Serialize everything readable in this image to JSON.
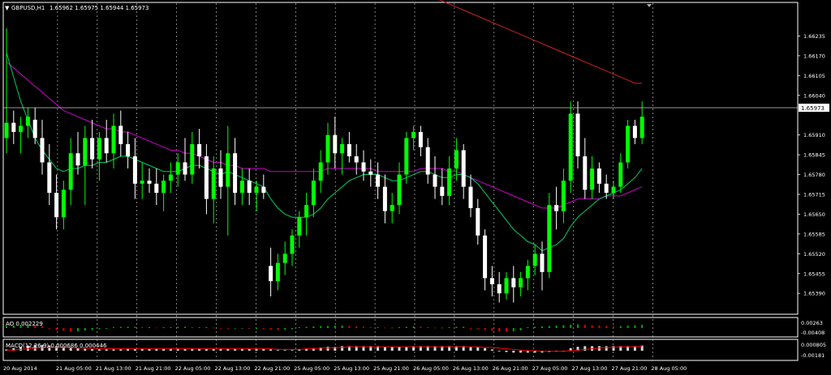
{
  "header": {
    "symbol": "GBPUSD,H1",
    "ohlc": "1.65962 1.65975 1.65944 1.65973",
    "menu_icon": "triangle-down-icon",
    "scroll_marker_icon": "triangle-down-icon"
  },
  "colors": {
    "background": "#000000",
    "bull_candle": "#00ff00",
    "bear_candle": "#ffffff",
    "ma_fast": "#00cc66",
    "ma_mid": "#cc00cc",
    "ma_slow": "#cc2222",
    "grid": "#d0d0d0",
    "ao_up": "#00aa00",
    "ao_down": "#dd0000",
    "macd_hist": "#d8d8d8",
    "macd_signal": "#ff0000"
  },
  "price_axis": {
    "labels": [
      "1.66235",
      "1.66170",
      "1.66105",
      "1.66040",
      "1.65910",
      "1.65845",
      "1.65780",
      "1.65715",
      "1.65650",
      "1.65585",
      "1.65520",
      "1.65455",
      "1.65390"
    ],
    "current_price": "1.65973"
  },
  "time_axis": {
    "labels": [
      "20 Aug 2014",
      "21 Aug 05:00",
      "21 Aug 13:00",
      "21 Aug 21:00",
      "22 Aug 05:00",
      "22 Aug 13:00",
      "22 Aug 21:00",
      "25 Aug 05:00",
      "25 Aug 13:00",
      "25 Aug 21:00",
      "26 Aug 05:00",
      "26 Aug 13:00",
      "26 Aug 21:00",
      "27 Aug 05:00",
      "27 Aug 13:00",
      "27 Aug 21:00",
      "28 Aug 05:00"
    ]
  },
  "ao_panel": {
    "title": "AO 0.002229",
    "labels": [
      "0.00263",
      "-0.00408"
    ]
  },
  "macd_panel": {
    "title": "MACD(12,26,9) 0.000686 0.000446",
    "labels": [
      "0.000805",
      "-0.00181"
    ]
  },
  "chart_data": {
    "type": "candlestick",
    "title": "GBPUSD,H1",
    "ylim": [
      1.6534,
      1.663
    ],
    "candles": [
      {
        "o": 1.659,
        "h": 1.6626,
        "l": 1.6585,
        "c": 1.6595
      },
      {
        "o": 1.6595,
        "h": 1.6599,
        "l": 1.6588,
        "c": 1.6592
      },
      {
        "o": 1.6592,
        "h": 1.6597,
        "l": 1.6585,
        "c": 1.6594
      },
      {
        "o": 1.6594,
        "h": 1.66,
        "l": 1.659,
        "c": 1.6597
      },
      {
        "o": 1.6596,
        "h": 1.66,
        "l": 1.6588,
        "c": 1.659
      },
      {
        "o": 1.659,
        "h": 1.6596,
        "l": 1.6578,
        "c": 1.6582
      },
      {
        "o": 1.6582,
        "h": 1.6588,
        "l": 1.6568,
        "c": 1.6572
      },
      {
        "o": 1.6572,
        "h": 1.6578,
        "l": 1.656,
        "c": 1.6564
      },
      {
        "o": 1.6564,
        "h": 1.6576,
        "l": 1.656,
        "c": 1.6573
      },
      {
        "o": 1.6573,
        "h": 1.659,
        "l": 1.6568,
        "c": 1.6585
      },
      {
        "o": 1.6585,
        "h": 1.6592,
        "l": 1.6578,
        "c": 1.6581
      },
      {
        "o": 1.6581,
        "h": 1.6594,
        "l": 1.6568,
        "c": 1.659
      },
      {
        "o": 1.659,
        "h": 1.6596,
        "l": 1.658,
        "c": 1.6583
      },
      {
        "o": 1.6583,
        "h": 1.6592,
        "l": 1.6576,
        "c": 1.659
      },
      {
        "o": 1.659,
        "h": 1.6596,
        "l": 1.6582,
        "c": 1.6585
      },
      {
        "o": 1.6585,
        "h": 1.6598,
        "l": 1.658,
        "c": 1.6594
      },
      {
        "o": 1.6594,
        "h": 1.6599,
        "l": 1.6584,
        "c": 1.6588
      },
      {
        "o": 1.6588,
        "h": 1.6592,
        "l": 1.658,
        "c": 1.6584
      },
      {
        "o": 1.6584,
        "h": 1.659,
        "l": 1.657,
        "c": 1.6575
      },
      {
        "o": 1.6575,
        "h": 1.6582,
        "l": 1.657,
        "c": 1.6576
      },
      {
        "o": 1.6576,
        "h": 1.658,
        "l": 1.6572,
        "c": 1.6575
      },
      {
        "o": 1.6575,
        "h": 1.658,
        "l": 1.6568,
        "c": 1.6572
      },
      {
        "o": 1.6572,
        "h": 1.6578,
        "l": 1.6566,
        "c": 1.6576
      },
      {
        "o": 1.6576,
        "h": 1.6582,
        "l": 1.6572,
        "c": 1.6578
      },
      {
        "o": 1.6578,
        "h": 1.6585,
        "l": 1.6574,
        "c": 1.6582
      },
      {
        "o": 1.6582,
        "h": 1.659,
        "l": 1.6576,
        "c": 1.6578
      },
      {
        "o": 1.6578,
        "h": 1.6592,
        "l": 1.6575,
        "c": 1.6588
      },
      {
        "o": 1.6588,
        "h": 1.6593,
        "l": 1.658,
        "c": 1.6584
      },
      {
        "o": 1.6584,
        "h": 1.6588,
        "l": 1.6565,
        "c": 1.657
      },
      {
        "o": 1.657,
        "h": 1.6584,
        "l": 1.6562,
        "c": 1.658
      },
      {
        "o": 1.658,
        "h": 1.6586,
        "l": 1.657,
        "c": 1.6574
      },
      {
        "o": 1.6574,
        "h": 1.6594,
        "l": 1.6558,
        "c": 1.6585
      },
      {
        "o": 1.6585,
        "h": 1.659,
        "l": 1.6568,
        "c": 1.6572
      },
      {
        "o": 1.6572,
        "h": 1.658,
        "l": 1.6568,
        "c": 1.6576
      },
      {
        "o": 1.6576,
        "h": 1.658,
        "l": 1.6568,
        "c": 1.6572
      },
      {
        "o": 1.6572,
        "h": 1.6576,
        "l": 1.6566,
        "c": 1.6574
      },
      {
        "o": 1.6574,
        "h": 1.6578,
        "l": 1.657,
        "c": 1.6572
      },
      {
        "o": 1.6548,
        "h": 1.6554,
        "l": 1.6538,
        "c": 1.6543
      },
      {
        "o": 1.6543,
        "h": 1.6552,
        "l": 1.654,
        "c": 1.6549
      },
      {
        "o": 1.6549,
        "h": 1.6556,
        "l": 1.6545,
        "c": 1.6552
      },
      {
        "o": 1.6552,
        "h": 1.656,
        "l": 1.6548,
        "c": 1.6558
      },
      {
        "o": 1.6558,
        "h": 1.6566,
        "l": 1.6554,
        "c": 1.6564
      },
      {
        "o": 1.6564,
        "h": 1.6572,
        "l": 1.6558,
        "c": 1.6568
      },
      {
        "o": 1.6568,
        "h": 1.658,
        "l": 1.6564,
        "c": 1.6576
      },
      {
        "o": 1.6576,
        "h": 1.6586,
        "l": 1.6572,
        "c": 1.6582
      },
      {
        "o": 1.6582,
        "h": 1.6595,
        "l": 1.6578,
        "c": 1.6591
      },
      {
        "o": 1.6591,
        "h": 1.6597,
        "l": 1.658,
        "c": 1.6585
      },
      {
        "o": 1.6585,
        "h": 1.659,
        "l": 1.6578,
        "c": 1.6588
      },
      {
        "o": 1.6588,
        "h": 1.6592,
        "l": 1.6582,
        "c": 1.6584
      },
      {
        "o": 1.6584,
        "h": 1.6588,
        "l": 1.6578,
        "c": 1.6582
      },
      {
        "o": 1.6582,
        "h": 1.6586,
        "l": 1.6576,
        "c": 1.6579
      },
      {
        "o": 1.6579,
        "h": 1.6583,
        "l": 1.6574,
        "c": 1.6578
      },
      {
        "o": 1.6578,
        "h": 1.6582,
        "l": 1.657,
        "c": 1.6574
      },
      {
        "o": 1.6574,
        "h": 1.6578,
        "l": 1.6562,
        "c": 1.6566
      },
      {
        "o": 1.6566,
        "h": 1.6572,
        "l": 1.6562,
        "c": 1.6568
      },
      {
        "o": 1.6568,
        "h": 1.6582,
        "l": 1.6565,
        "c": 1.6578
      },
      {
        "o": 1.6578,
        "h": 1.6592,
        "l": 1.6575,
        "c": 1.659
      },
      {
        "o": 1.659,
        "h": 1.6594,
        "l": 1.6586,
        "c": 1.6592
      },
      {
        "o": 1.6592,
        "h": 1.6594,
        "l": 1.6584,
        "c": 1.6587
      },
      {
        "o": 1.6587,
        "h": 1.659,
        "l": 1.6575,
        "c": 1.6578
      },
      {
        "o": 1.6578,
        "h": 1.6584,
        "l": 1.657,
        "c": 1.6574
      },
      {
        "o": 1.6574,
        "h": 1.658,
        "l": 1.6568,
        "c": 1.6571
      },
      {
        "o": 1.6571,
        "h": 1.6584,
        "l": 1.6568,
        "c": 1.658
      },
      {
        "o": 1.658,
        "h": 1.659,
        "l": 1.6576,
        "c": 1.6586
      },
      {
        "o": 1.6586,
        "h": 1.6588,
        "l": 1.657,
        "c": 1.6574
      },
      {
        "o": 1.6574,
        "h": 1.6578,
        "l": 1.6564,
        "c": 1.6567
      },
      {
        "o": 1.6567,
        "h": 1.657,
        "l": 1.6555,
        "c": 1.6558
      },
      {
        "o": 1.6558,
        "h": 1.656,
        "l": 1.654,
        "c": 1.6544
      },
      {
        "o": 1.6544,
        "h": 1.6548,
        "l": 1.6538,
        "c": 1.6542
      },
      {
        "o": 1.6542,
        "h": 1.6546,
        "l": 1.6536,
        "c": 1.6539
      },
      {
        "o": 1.6539,
        "h": 1.6546,
        "l": 1.6537,
        "c": 1.6544
      },
      {
        "o": 1.6544,
        "h": 1.6548,
        "l": 1.6536,
        "c": 1.6541
      },
      {
        "o": 1.6541,
        "h": 1.6546,
        "l": 1.6538,
        "c": 1.6544
      },
      {
        "o": 1.6544,
        "h": 1.655,
        "l": 1.654,
        "c": 1.6548
      },
      {
        "o": 1.6548,
        "h": 1.6555,
        "l": 1.6545,
        "c": 1.6552
      },
      {
        "o": 1.6552,
        "h": 1.6556,
        "l": 1.654,
        "c": 1.6546
      },
      {
        "o": 1.6546,
        "h": 1.6572,
        "l": 1.6544,
        "c": 1.6568
      },
      {
        "o": 1.6568,
        "h": 1.6574,
        "l": 1.656,
        "c": 1.6566
      },
      {
        "o": 1.6566,
        "h": 1.658,
        "l": 1.6562,
        "c": 1.6576
      },
      {
        "o": 1.6576,
        "h": 1.6602,
        "l": 1.6572,
        "c": 1.6598
      },
      {
        "o": 1.6598,
        "h": 1.6602,
        "l": 1.658,
        "c": 1.6584
      },
      {
        "o": 1.6584,
        "h": 1.659,
        "l": 1.657,
        "c": 1.6573
      },
      {
        "o": 1.6573,
        "h": 1.6584,
        "l": 1.657,
        "c": 1.658
      },
      {
        "o": 1.658,
        "h": 1.6582,
        "l": 1.6572,
        "c": 1.6575
      },
      {
        "o": 1.6575,
        "h": 1.6578,
        "l": 1.657,
        "c": 1.6572
      },
      {
        "o": 1.6572,
        "h": 1.6576,
        "l": 1.657,
        "c": 1.6574
      },
      {
        "o": 1.6574,
        "h": 1.6585,
        "l": 1.6572,
        "c": 1.6582
      },
      {
        "o": 1.6582,
        "h": 1.6596,
        "l": 1.658,
        "c": 1.6594
      },
      {
        "o": 1.6594,
        "h": 1.6596,
        "l": 1.6588,
        "c": 1.659
      },
      {
        "o": 1.659,
        "h": 1.6602,
        "l": 1.6588,
        "c": 1.6597
      }
    ],
    "ma_fast": [
      1.6618,
      1.661,
      1.6602,
      1.6596,
      1.659,
      1.6586,
      1.6583,
      1.658,
      1.6579,
      1.658,
      1.658,
      1.6581,
      1.6581,
      1.6582,
      1.6582,
      1.6583,
      1.6584,
      1.6584,
      1.6583,
      1.6582,
      1.6581,
      1.658,
      1.6579,
      1.6579,
      1.6579,
      1.658,
      1.6581,
      1.6581,
      1.658,
      1.6579,
      1.6578,
      1.6579,
      1.6578,
      1.6577,
      1.6576,
      1.6575,
      1.6574,
      1.657,
      1.6567,
      1.6565,
      1.6564,
      1.6564,
      1.6564,
      1.6565,
      1.6567,
      1.657,
      1.6572,
      1.6574,
      1.6576,
      1.6577,
      1.6578,
      1.6578,
      1.6578,
      1.6577,
      1.6576,
      1.6576,
      1.6577,
      1.6578,
      1.6579,
      1.6579,
      1.6578,
      1.6577,
      1.6577,
      1.6578,
      1.6578,
      1.6577,
      1.6575,
      1.6572,
      1.6569,
      1.6566,
      1.6563,
      1.656,
      1.6558,
      1.6556,
      1.6555,
      1.6553,
      1.6554,
      1.6555,
      1.6557,
      1.6561,
      1.6564,
      1.6566,
      1.6568,
      1.657,
      1.6571,
      1.6572,
      1.6573,
      1.6575,
      1.6577,
      1.658
    ],
    "ma_mid": [
      1.6615,
      1.6613,
      1.6611,
      1.6609,
      1.6607,
      1.6605,
      1.6603,
      1.6601,
      1.6599,
      1.6598,
      1.6597,
      1.6596,
      1.6595,
      1.6594,
      1.6593,
      1.6593,
      1.6592,
      1.6592,
      1.6591,
      1.659,
      1.6589,
      1.6588,
      1.6587,
      1.6586,
      1.6586,
      1.6585,
      1.6585,
      1.6584,
      1.6583,
      1.6582,
      1.6582,
      1.6581,
      1.6581,
      1.658,
      1.658,
      1.658,
      1.658,
      1.6579,
      1.6579,
      1.6579,
      1.6579,
      1.6579,
      1.6579,
      1.6579,
      1.6579,
      1.658,
      1.658,
      1.658,
      1.658,
      1.658,
      1.658,
      1.658,
      1.6579,
      1.6579,
      1.6579,
      1.6579,
      1.6579,
      1.6579,
      1.658,
      1.658,
      1.658,
      1.658,
      1.6579,
      1.6579,
      1.6578,
      1.6577,
      1.6576,
      1.6575,
      1.6574,
      1.6573,
      1.6572,
      1.6571,
      1.657,
      1.6569,
      1.6568,
      1.6567,
      1.6567,
      1.6567,
      1.6568,
      1.6569,
      1.657,
      1.657,
      1.657,
      1.657,
      1.6571,
      1.6571,
      1.6571,
      1.6572,
      1.6573,
      1.6574
    ],
    "ma_slow": [
      1.6642,
      1.6641,
      1.664,
      1.6639,
      1.6638,
      1.6637,
      1.6636,
      1.6635,
      1.6634,
      1.6633,
      1.6632,
      1.6631,
      1.663,
      1.6629,
      1.6628,
      1.6627,
      1.6626,
      1.6625,
      1.6624,
      1.6623,
      1.6622,
      1.6621,
      1.662,
      1.6619,
      1.6618,
      1.6617,
      1.6616,
      1.6615,
      1.6614,
      1.6613,
      1.6612,
      1.6611,
      1.661,
      1.6609,
      1.6608,
      1.6608
    ],
    "ao": [
      0.5,
      0.6,
      0.7,
      0.8,
      0.6,
      0.4,
      -0.2,
      -0.5,
      -0.7,
      -0.8,
      -0.8,
      -0.6,
      -0.5,
      -0.3,
      -0.2,
      0.2,
      0.3,
      0.3,
      0.3,
      0.2,
      0.2,
      0.1,
      0.2,
      0.2,
      0.3,
      0.3,
      0.2,
      0.2,
      0.2,
      0.1,
      -0.1,
      -0.2,
      -0.1,
      -0.1,
      -0.2,
      -0.2,
      -0.3,
      -0.4,
      -0.5,
      -0.4,
      -0.3,
      0.2,
      0.3,
      0.4,
      0.5,
      0.5,
      0.6,
      0.6,
      0.5,
      0.4,
      0.3,
      0.2,
      0.2,
      0.1,
      0.1,
      0.2,
      0.3,
      0.4,
      0.3,
      0.2,
      0.1,
      0.1,
      0.2,
      0.3,
      0.3,
      -0.2,
      -0.3,
      -0.5,
      -0.7,
      -0.8,
      -0.9,
      -0.8,
      -0.6,
      0.2,
      0.3,
      0.4,
      0.5,
      0.6,
      0.7,
      0.8,
      0.9,
      0.8,
      0.7,
      0.6,
      0.5,
      0.4,
      0.5,
      0.6,
      0.7,
      0.8
    ],
    "macd": [
      0.2,
      0.4,
      0.6,
      0.8,
      0.9,
      0.9,
      0.8,
      0.7,
      0.6,
      0.5,
      0.4,
      0.3,
      0.3,
      0.2,
      0.2,
      0.2,
      0.2,
      0.3,
      0.3,
      0.3,
      0.3,
      0.3,
      0.3,
      0.3,
      0.3,
      0.3,
      0.3,
      0.3,
      0.3,
      0.3,
      0.3,
      0.3,
      0.3,
      0.3,
      0.3,
      0.3,
      0.3,
      0.2,
      0.1,
      0.1,
      0.1,
      0.2,
      0.3,
      0.4,
      0.5,
      0.6,
      0.6,
      0.7,
      0.7,
      0.7,
      0.7,
      0.7,
      0.7,
      0.6,
      0.6,
      0.6,
      0.6,
      0.7,
      0.7,
      0.7,
      0.7,
      0.7,
      0.7,
      0.7,
      0.7,
      0.6,
      0.5,
      0.4,
      0.2,
      0.0,
      -0.2,
      -0.3,
      -0.3,
      -0.3,
      -0.3,
      -0.3,
      -0.2,
      -0.1,
      0.0,
      0.4,
      0.6,
      0.7,
      0.7,
      0.7,
      0.7,
      0.7,
      0.7,
      0.7,
      0.7,
      0.8
    ],
    "macd_signal": [
      0.1,
      0.1,
      0.2,
      0.3,
      0.4,
      0.5,
      0.5,
      0.5,
      0.5,
      0.5,
      0.4,
      0.4,
      0.3,
      0.3,
      0.3,
      0.3,
      0.3,
      0.3,
      0.3,
      0.3,
      0.3,
      0.3,
      0.3,
      0.3,
      0.3,
      0.3,
      0.3,
      0.3,
      0.3,
      0.3,
      0.3,
      0.3,
      0.3,
      0.3,
      0.3,
      0.3,
      0.3,
      0.3,
      0.2,
      0.2,
      0.2,
      0.2,
      0.3,
      0.3,
      0.4,
      0.4,
      0.5,
      0.5,
      0.6,
      0.6,
      0.6,
      0.6,
      0.6,
      0.6,
      0.6,
      0.6,
      0.6,
      0.6,
      0.6,
      0.6,
      0.6,
      0.6,
      0.6,
      0.6,
      0.6,
      0.6,
      0.6,
      0.5,
      0.5,
      0.4,
      0.3,
      0.2,
      0.1,
      0.0,
      0.0,
      -0.1,
      -0.1,
      -0.1,
      -0.1,
      0.0,
      0.1,
      0.2,
      0.3,
      0.4,
      0.5,
      0.5,
      0.6,
      0.6,
      0.6,
      0.7
    ]
  }
}
